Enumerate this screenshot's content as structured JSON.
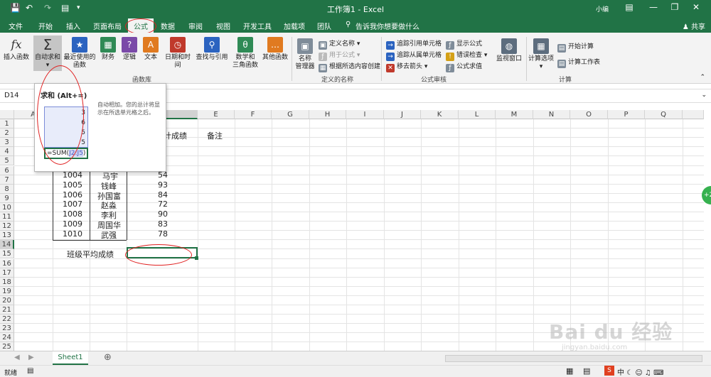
{
  "app": {
    "title": "工作簿1 - Excel",
    "account": "小编",
    "share": "共享"
  },
  "tabs": [
    "文件",
    "开始",
    "插入",
    "页面布局",
    "公式",
    "数据",
    "审阅",
    "视图",
    "开发工具",
    "加载项",
    "团队"
  ],
  "active_tab": "公式",
  "tell_me": "告诉我你想要做什么",
  "ribbon": {
    "insert_function": "插入函数",
    "autosum": "自动求和",
    "recent_line1": "最近使用的",
    "recent_line2": "函数",
    "financial": "财务",
    "logical": "逻辑",
    "text": "文本",
    "datetime": "日期和时间",
    "lookup": "查找与引用",
    "math_line1": "数学和",
    "math_line2": "三角函数",
    "more": "其他函数",
    "group_library": "函数库",
    "name_manager_line1": "名称",
    "name_manager_line2": "管理器",
    "define_name": "定义名称",
    "use_in_formula": "用于公式",
    "create_from_selection": "根据所选内容创建",
    "group_names": "定义的名称",
    "trace_precedents": "追踪引用单元格",
    "trace_dependents": "追踪从属单元格",
    "remove_arrows": "移去箭头",
    "show_formulas": "显示公式",
    "error_checking": "错误检查",
    "evaluate_formula": "公式求值",
    "group_audit": "公式审核",
    "watch_window": "监视窗口",
    "calc_options": "计算选项",
    "calc_now": "开始计算",
    "calc_sheet": "计算工作表",
    "group_calc": "计算"
  },
  "name_box": "D14",
  "tooltip": {
    "title": "求和 (Alt+=)",
    "desc": "自动相加。您的总计将显示在所选单元格之后。",
    "values": [
      "3",
      "6",
      "5",
      "5"
    ],
    "formula_prefix": "=SUM(",
    "formula_ref": "J2:J5",
    "formula_suffix": ")"
  },
  "columns": [
    "A",
    "B",
    "C",
    "D",
    "E",
    "F",
    "G",
    "H",
    "I",
    "J",
    "K",
    "L",
    "M",
    "N",
    "O",
    "P",
    "Q"
  ],
  "rows": [
    "1",
    "2",
    "3",
    "4",
    "5",
    "6",
    "7",
    "8",
    "9",
    "10",
    "11",
    "12",
    "13",
    "14",
    "15",
    "16",
    "17",
    "18",
    "19",
    "20",
    "21",
    "22",
    "23",
    "24",
    "25"
  ],
  "header_cells": {
    "score_partial": "计成绩",
    "remarks": "备注"
  },
  "records": [
    {
      "id": "1004",
      "name": "马宇",
      "score": "54"
    },
    {
      "id": "1005",
      "name": "钱峰",
      "score": "93"
    },
    {
      "id": "1006",
      "name": "孙国富",
      "score": "84"
    },
    {
      "id": "1007",
      "name": "赵淼",
      "score": "72"
    },
    {
      "id": "1008",
      "name": "李利",
      "score": "90"
    },
    {
      "id": "1009",
      "name": "周国华",
      "score": "83"
    },
    {
      "id": "1010",
      "name": "武强",
      "score": "78"
    }
  ],
  "avg_label": "班级平均成绩",
  "sheet_tab": "Sheet1",
  "status": "就绪",
  "side_badge": "+2",
  "watermark": {
    "logo": "Bai du 经验",
    "url": "jingyan.baidu.com"
  }
}
